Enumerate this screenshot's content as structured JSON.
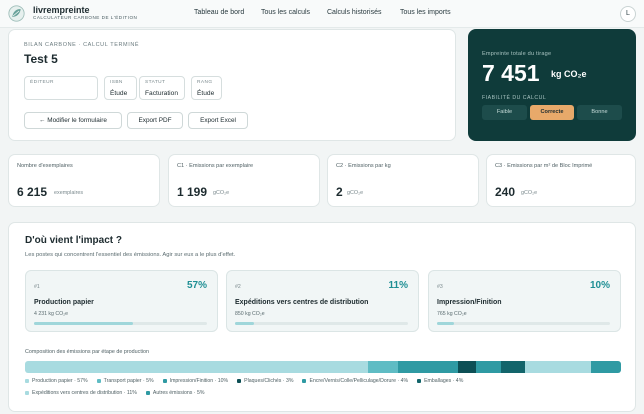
{
  "nav": {
    "brand": "livrempreinte",
    "tagline": "Calculateur carbone de l'édition",
    "links": [
      "Tableau de bord",
      "Tous les calculs",
      "Calculs historisés",
      "Tous les imports"
    ],
    "avatar": "L"
  },
  "calc": {
    "overline": "Bilan carbone · Calcul terminé",
    "title": "Test 5",
    "fields": [
      {
        "label": "Éditeur",
        "value": ""
      },
      {
        "label": "ISBN",
        "value": "Étude"
      },
      {
        "label": "Statut",
        "value": "Facturation"
      },
      {
        "label": "Rang",
        "value": "Étude"
      }
    ],
    "buttons": {
      "edit": "← Modifier le formulaire",
      "pdf": "Export PDF",
      "excel": "Export Excel"
    }
  },
  "footprint": {
    "label": "Empreinte totale du tirage",
    "value": "7 451",
    "unit": "kg CO₂e",
    "reliability_label": "Fiabilité du calcul",
    "reliability_options": [
      "Faible",
      "Correcte",
      "Bonne"
    ],
    "reliability_selected": "Correcte"
  },
  "stats": [
    {
      "title": "Nombre d'exemplaires",
      "value": "6 215",
      "unit": "exemplaires"
    },
    {
      "title": "C1 · Emissions par exemplaire",
      "value": "1 199",
      "unit": "gCO₂e"
    },
    {
      "title": "C2 · Emissions par kg",
      "value": "2",
      "unit": "gCO₂e"
    },
    {
      "title": "C3 · Emissions par m² de Bloc Imprimé",
      "value": "240",
      "unit": "gCO₂e"
    }
  ],
  "impact": {
    "title": "D'où vient l'impact ?",
    "subtitle": "Les postes qui concentrent l'essentiel des émissions. Agir sur eux a le plus d'effet.",
    "top": [
      {
        "rank": "#1",
        "name": "Production papier",
        "pct_label": "57%",
        "kg": "4 231 kg CO₂e",
        "share": 0.57
      },
      {
        "rank": "#2",
        "name": "Expéditions vers centres de distribution",
        "pct_label": "11%",
        "kg": "850 kg CO₂e",
        "share": 0.11
      },
      {
        "rank": "#3",
        "name": "Impression/Finition",
        "pct_label": "10%",
        "kg": "765 kg CO₂e",
        "share": 0.1
      }
    ],
    "composition_title": "Composition des émissions par étape de production",
    "composition": [
      {
        "label": "Production papier · 57%",
        "share": 57,
        "color": "#a8dbe0"
      },
      {
        "label": "Transport papier · 5%",
        "share": 5,
        "color": "#5fbcc4"
      },
      {
        "label": "Impression/Finition · 10%",
        "share": 10,
        "color": "#2f9aa3"
      },
      {
        "label": "Plaques/Clichés · 3%",
        "share": 3,
        "color": "#0d4f55"
      },
      {
        "label": "Encre/Vernis/Colle/Pelliculage/Dorure · 4%",
        "share": 4,
        "color": "#2f9aa3"
      },
      {
        "label": "Emballages · 4%",
        "share": 4,
        "color": "#13656b"
      },
      {
        "label": "Expéditions vers centres de distribution · 11%",
        "share": 11,
        "color": "#a8dbe0"
      },
      {
        "label": "Autres émissions · 5%",
        "share": 5,
        "color": "#2f9aa3"
      }
    ]
  }
}
